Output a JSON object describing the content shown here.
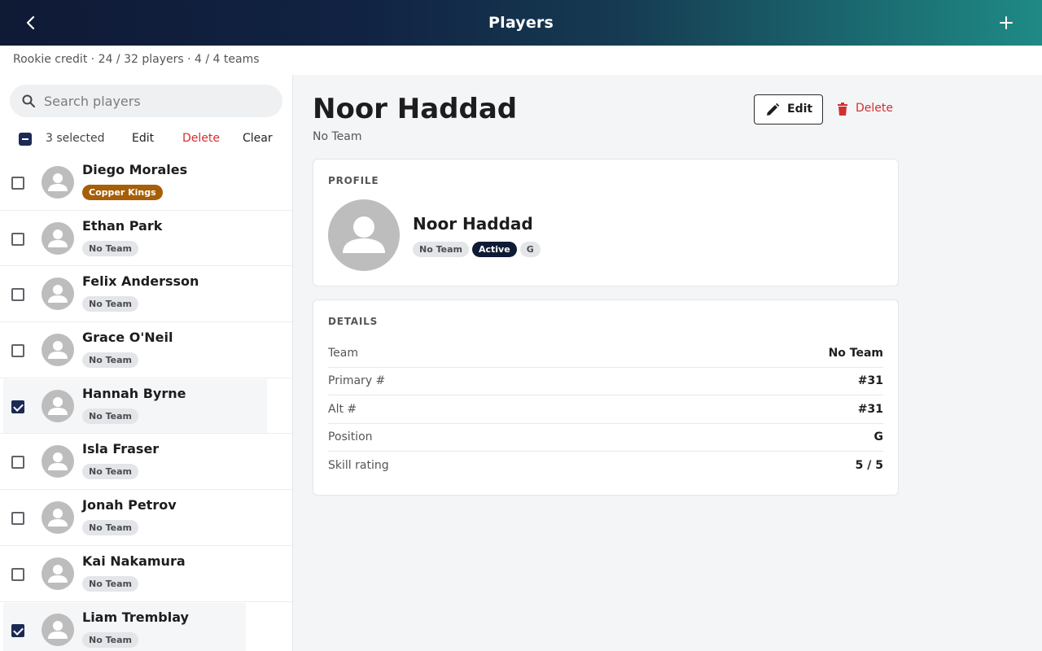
{
  "header": {
    "title": "Players"
  },
  "summary": "Rookie credit · 24 / 32 players · 4 / 4 teams",
  "search": {
    "placeholder": "Search players",
    "value": ""
  },
  "selection": {
    "count_label": "3 selected",
    "edit": "Edit",
    "delete": "Delete",
    "clear": "Clear"
  },
  "players": [
    {
      "name": "Diego Morales",
      "team": "Copper Kings",
      "selected": false
    },
    {
      "name": "Ethan Park",
      "team": "No Team",
      "selected": false
    },
    {
      "name": "Felix Andersson",
      "team": "No Team",
      "selected": false
    },
    {
      "name": "Grace O'Neil",
      "team": "No Team",
      "selected": false
    },
    {
      "name": "Hannah Byrne",
      "team": "No Team",
      "selected": true
    },
    {
      "name": "Isla Fraser",
      "team": "No Team",
      "selected": false
    },
    {
      "name": "Jonah Petrov",
      "team": "No Team",
      "selected": false
    },
    {
      "name": "Kai Nakamura",
      "team": "No Team",
      "selected": false
    },
    {
      "name": "Liam Tremblay",
      "team": "No Team",
      "selected": true
    }
  ],
  "detail": {
    "name": "Noor Haddad",
    "team": "No Team",
    "edit_label": "Edit",
    "delete_label": "Delete",
    "profile": {
      "heading": "PROFILE",
      "name": "Noor Haddad",
      "chips": [
        "No Team",
        "Active",
        "G"
      ]
    },
    "details": {
      "heading": "DETAILS",
      "rows": [
        {
          "label": "Team",
          "value": "No Team"
        },
        {
          "label": "Primary #",
          "value": "#31"
        },
        {
          "label": "Alt #",
          "value": "#31"
        },
        {
          "label": "Position",
          "value": "G"
        },
        {
          "label": "Skill rating",
          "value": "5 / 5"
        }
      ]
    }
  },
  "colors": {
    "accent": "#1a2a55",
    "danger": "#d32f2f",
    "copper_chip": "#a65e07",
    "active_chip": "#0f1a35"
  },
  "icons": {
    "back": "chevron-left-icon",
    "add": "plus-icon",
    "search": "search-icon",
    "edit": "pencil-icon",
    "delete": "trash-icon",
    "avatar": "person-icon"
  }
}
